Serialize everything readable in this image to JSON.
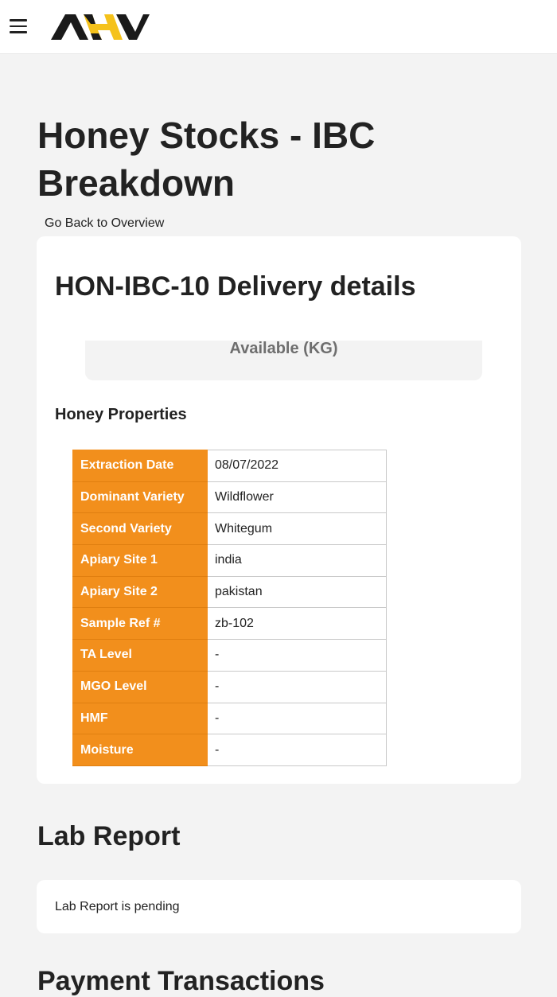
{
  "header": {
    "menu_icon": "hamburger-menu-icon",
    "logo_text": "AHV",
    "colors": {
      "logo_dark": "#1a1a1a",
      "logo_accent": "#f5c21b"
    }
  },
  "page": {
    "title": "Honey Stocks - IBC Breakdown",
    "back_link": "Go Back to Overview"
  },
  "delivery": {
    "title": "HON-IBC-10 Delivery details",
    "available_label": "Available (KG)",
    "properties_title": "Honey Properties",
    "properties": [
      {
        "label": "Extraction Date",
        "value": "08/07/2022"
      },
      {
        "label": "Dominant Variety",
        "value": "Wildflower"
      },
      {
        "label": "Second Variety",
        "value": "Whitegum"
      },
      {
        "label": "Apiary Site 1",
        "value": "india"
      },
      {
        "label": "Apiary Site 2",
        "value": "pakistan"
      },
      {
        "label": "Sample Ref #",
        "value": "zb-102"
      },
      {
        "label": "TA Level",
        "value": "-"
      },
      {
        "label": "MGO Level",
        "value": "-"
      },
      {
        "label": "HMF",
        "value": "-"
      },
      {
        "label": "Moisture",
        "value": "-"
      }
    ],
    "colors": {
      "label_bg": "#f28f1c"
    }
  },
  "lab_report": {
    "title": "Lab Report",
    "status": "Lab Report is pending"
  },
  "payments": {
    "title": "Payment Transactions"
  }
}
